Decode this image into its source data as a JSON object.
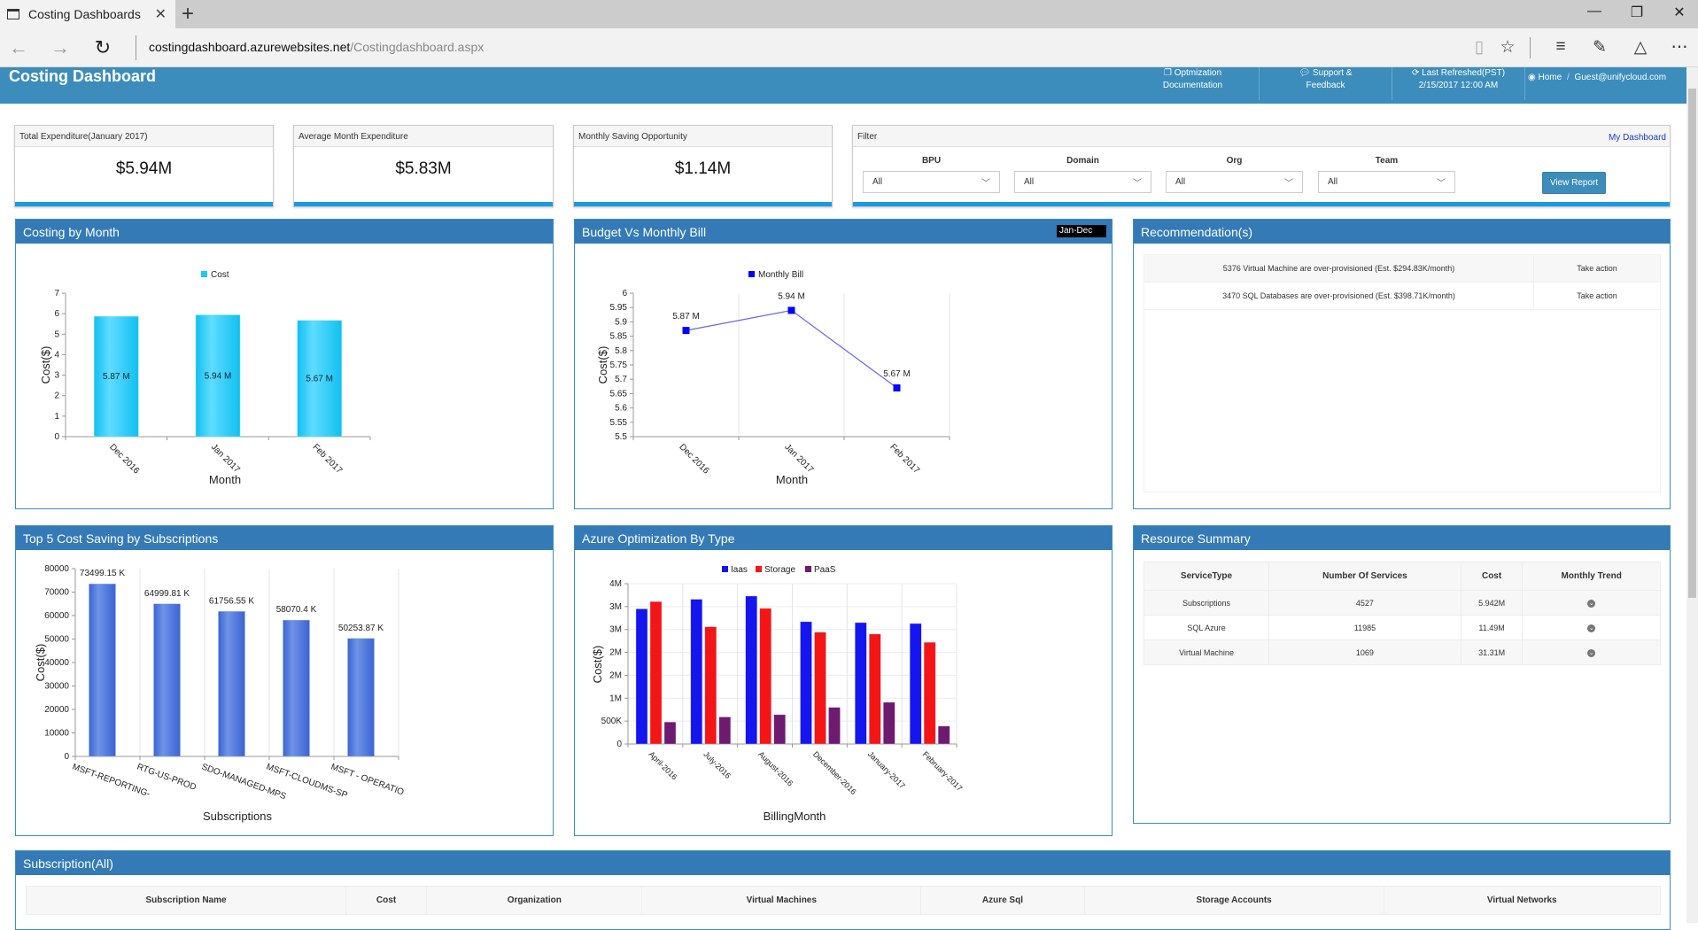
{
  "browser": {
    "tab_title": "Costing Dashboards",
    "url_host": "costingdashboard.azurewebsites.net",
    "url_path": "/Costingdashboard.aspx",
    "icons": [
      "back-icon",
      "forward-icon",
      "refresh-icon",
      "reading-view-icon",
      "favorite-star-icon",
      "hub-icon",
      "web-note-icon",
      "share-icon",
      "more-icon"
    ]
  },
  "header": {
    "title": "Costing Dashboard",
    "optimization_line1": "Optmization",
    "optimization_line2": "Documentation",
    "support_line1": "Support &",
    "support_line2": "Feedback",
    "refreshed_line1": "Last Refreshed(PST)",
    "refreshed_line2": "2/15/2017 12:00 AM",
    "home": "Home",
    "separator": "/",
    "user": "Guest@unifycloud.com"
  },
  "kpis": [
    {
      "label": "Total Expenditure(January 2017)",
      "value": "$5.94M"
    },
    {
      "label": "Average Month Expenditure",
      "value": "$5.83M"
    },
    {
      "label": "Monthly Saving Opportunity",
      "value": "$1.14M"
    }
  ],
  "filter": {
    "title": "Filter",
    "my_dashboard": "My Dashboard",
    "fields": [
      {
        "label": "BPU",
        "value": "All"
      },
      {
        "label": "Domain",
        "value": "All"
      },
      {
        "label": "Org",
        "value": "All"
      },
      {
        "label": "Team",
        "value": "All"
      }
    ],
    "view_report": "View Report"
  },
  "panels": {
    "costing_by_month": "Costing by Month",
    "budget_vs_bill": "Budget Vs Monthly Bill",
    "budget_range": "Jan-Dec",
    "recommendations": "Recommendation(s)",
    "top5": "Top 5 Cost Saving by Subscriptions",
    "azure_opt": "Azure Optimization By Type",
    "resource_summary": "Resource Summary",
    "subscriptions": "Subscription(All)"
  },
  "recommendations": [
    {
      "text": "5376 Virtual Machine are over-provisioned (Est. $294.83K/month)",
      "action": "Take action"
    },
    {
      "text": "3470 SQL Databases are over-provisioned (Est. $398.71K/month)",
      "action": "Take action"
    }
  ],
  "resource_summary": {
    "headers": [
      "ServiceType",
      "Number Of Services",
      "Cost",
      "Monthly Trend"
    ],
    "rows": [
      {
        "type": "Subscriptions",
        "count": "4527",
        "cost": "5.942M"
      },
      {
        "type": "SQL Azure",
        "count": "11985",
        "cost": "11.49M"
      },
      {
        "type": "Virtual Machine",
        "count": "1069",
        "cost": "31.31M"
      }
    ]
  },
  "subscription_table": {
    "headers": [
      "Subscription Name",
      "Cost",
      "Organization",
      "Virtual Machines",
      "Azure Sql",
      "Storage Accounts",
      "Virtual Networks"
    ]
  },
  "chart_data": [
    {
      "type": "bar",
      "title": "Costing by Month",
      "categories": [
        "Dec 2016",
        "Jan 2017",
        "Feb 2017"
      ],
      "series": [
        {
          "name": "Cost",
          "values": [
            5.87,
            5.94,
            5.67
          ],
          "color": "#1ec8f5"
        }
      ],
      "data_labels": [
        "5.87 M",
        "5.94 M",
        "5.67 M"
      ],
      "xlabel": "Month",
      "ylabel": "Cost($)",
      "ylim": [
        0,
        7
      ],
      "yticks": [
        0,
        1,
        2,
        3,
        4,
        5,
        6,
        7
      ],
      "legend": "top-center",
      "grid": false
    },
    {
      "type": "line",
      "title": "Budget Vs Monthly Bill",
      "categories": [
        "Dec 2016",
        "Jan 2017",
        "Feb 2017"
      ],
      "series": [
        {
          "name": "Monthly Bill",
          "values": [
            5.87,
            5.94,
            5.67
          ],
          "color": "#0000ff"
        }
      ],
      "data_labels": [
        "5.87 M",
        "5.94 M",
        "5.67 M"
      ],
      "xlabel": "Month",
      "ylabel": "Cost($)",
      "ylim": [
        5.5,
        6
      ],
      "yticks": [
        "5.5",
        "5.55",
        "5.6",
        "5.65",
        "5.7",
        "5.75",
        "5.8",
        "5.85",
        "5.9",
        "5.95",
        "6"
      ],
      "legend": "top-center",
      "grid": true
    },
    {
      "type": "bar",
      "title": "Top 5 Cost Saving by Subscriptions",
      "categories": [
        "MSFT-REPORTING-",
        "RTG-US-PROD",
        "SDO-MANAGED-MPS",
        "MSFT-CLOUDMS-SP",
        "MSFT - OPERATIO"
      ],
      "series": [
        {
          "name": "Cost",
          "values": [
            73499.15,
            64999.81,
            61756.55,
            58070.4,
            50253.87
          ],
          "color": "#3f6fd8"
        }
      ],
      "data_labels": [
        "73499.15 K",
        "64999.81 K",
        "61756.55 K",
        "58070.4 K",
        "50253.87 K"
      ],
      "xlabel": "Subscriptions",
      "ylabel": "Cost($)",
      "ylim": [
        0,
        80000
      ],
      "yticks": [
        0,
        10000,
        20000,
        30000,
        40000,
        50000,
        60000,
        70000,
        80000
      ],
      "grid": true
    },
    {
      "type": "bar",
      "title": "Azure Optimization By Type",
      "categories": [
        "April-2016",
        "July-2016",
        "August-2016",
        "December-2016",
        "January-2017",
        "February-2017"
      ],
      "series": [
        {
          "name": "Iaas",
          "values": [
            2.95,
            3.16,
            3.23,
            2.67,
            2.65,
            2.63
          ],
          "color": "#1515f0"
        },
        {
          "name": "Storage",
          "values": [
            3.11,
            2.56,
            2.96,
            2.44,
            2.4,
            2.22
          ],
          "color": "#f51515"
        },
        {
          "name": "PaaS",
          "values": [
            0.48,
            0.59,
            0.64,
            0.8,
            0.91,
            0.39
          ],
          "color": "#6e1a6e"
        }
      ],
      "unit": "M",
      "xlabel": "BillingMonth",
      "ylabel": "Cost($)",
      "ylim": [
        0,
        3.5
      ],
      "yticks": [
        "0",
        "500K",
        "1M",
        "2M",
        "2M",
        "3M",
        "3M",
        "4M"
      ],
      "legend": "top-center",
      "grid": true
    }
  ]
}
